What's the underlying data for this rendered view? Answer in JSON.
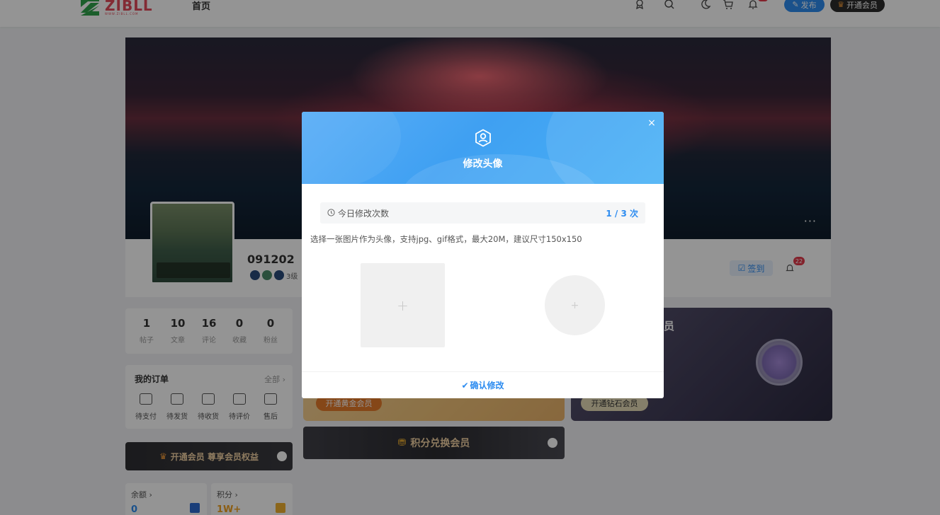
{
  "header": {
    "logo_text": "ZIBLL",
    "logo_subtext": "WWW.ZIBLL.COM",
    "nav_home": "首页",
    "publish_label": "发布",
    "vip_label": "开通会员"
  },
  "profile": {
    "username": "091202",
    "level_text": "3级",
    "signin_label": "签到",
    "bell_count": "22",
    "more_dots": "···"
  },
  "stats": [
    {
      "num": "1",
      "label": "帖子"
    },
    {
      "num": "10",
      "label": "文章"
    },
    {
      "num": "16",
      "label": "评论"
    },
    {
      "num": "0",
      "label": "收藏"
    },
    {
      "num": "0",
      "label": "粉丝"
    }
  ],
  "orders": {
    "title": "我的订单",
    "all_label": "全部 ›",
    "items": [
      "待支付",
      "待发货",
      "待收货",
      "待评价",
      "售后"
    ]
  },
  "vip_strip_label": "开通会员 尊享会员权益",
  "balance": {
    "title": "余额 ›",
    "value": "0",
    "points_title": "积分 ›",
    "points_value": "1W+"
  },
  "cards": {
    "gold_button": "开通黄金会员",
    "diamond_title": "员",
    "diamond_button": "开通钻石会员",
    "points_exchange": "积分兑换会员"
  },
  "modal": {
    "title": "修改头像",
    "close_symbol": "×",
    "quota_label": "今日修改次数",
    "quota_value": "1 / 3 次",
    "hint": "选择一张图片作为头像，支持jpg、gif格式，最大20M，建议尺寸150x150",
    "upload_plus": "+",
    "confirm_label": "确认修改",
    "confirm_check": "✔"
  },
  "colors": {
    "accent": "#2d8cf0",
    "modal_header": "#49b1f5",
    "overlay": "rgba(0,0,0,0.42)"
  }
}
